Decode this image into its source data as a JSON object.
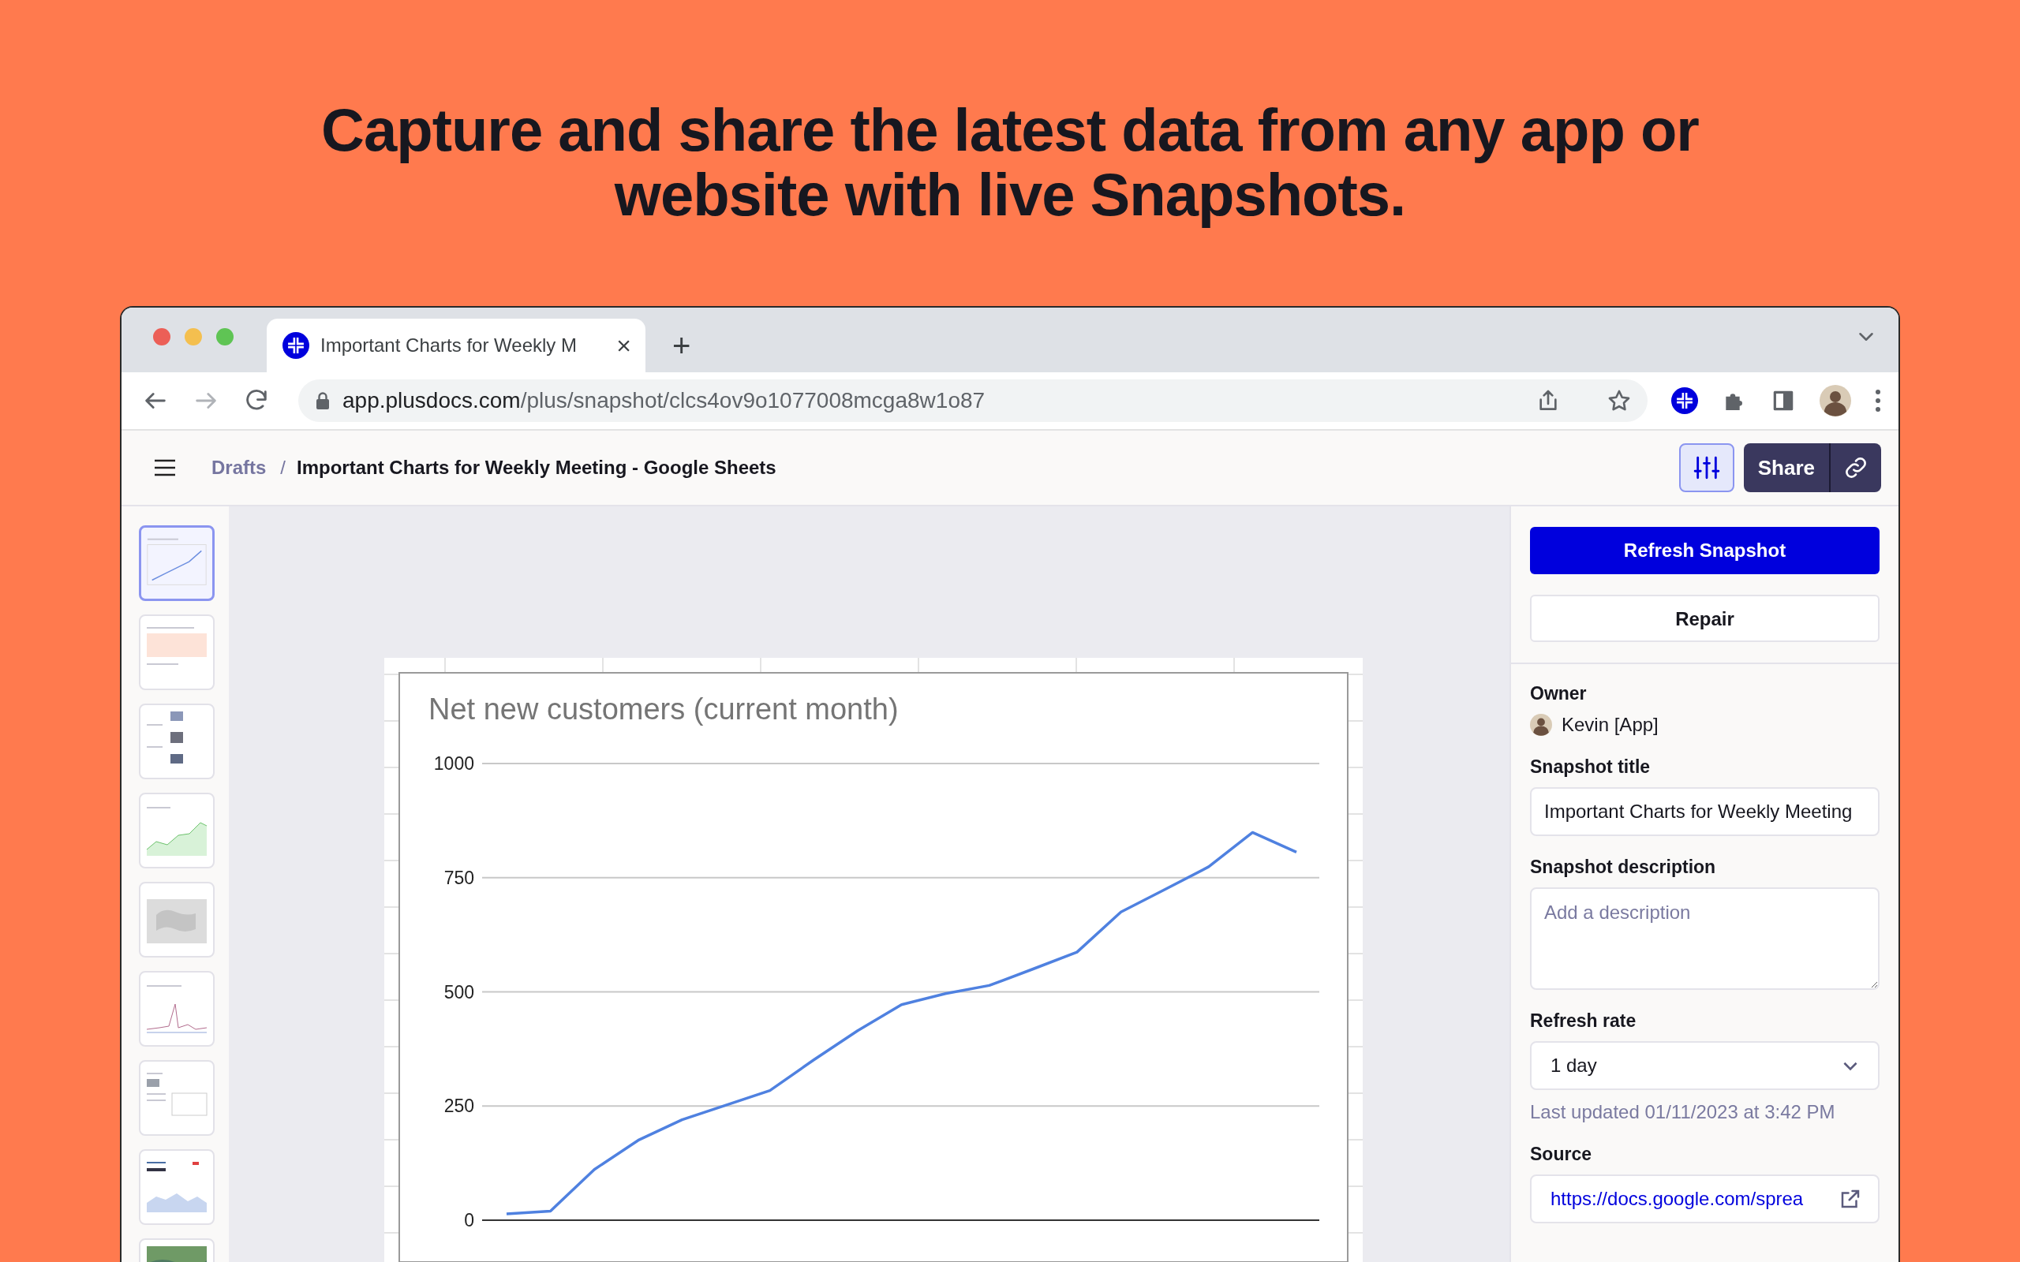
{
  "headline": "Capture and share the latest data from any app or website with live Snapshots.",
  "browser": {
    "tab": {
      "title": "Important Charts for Weekly M",
      "close": "×"
    },
    "new_tab": "+",
    "address": {
      "host": "app.plusdocs.com",
      "path": "/plus/snapshot/clcs4ov9o1077008mcga8w1o87"
    }
  },
  "header": {
    "breadcrumbs": [
      {
        "label": "Drafts",
        "kind": "link"
      },
      {
        "label": "/",
        "kind": "separator"
      },
      {
        "label": "Important Charts for Weekly Meeting - Google Sheets",
        "kind": "current"
      }
    ],
    "share_button": "Share"
  },
  "thumbnails": [
    {
      "kind": "line-chart",
      "selected": true
    },
    {
      "kind": "banner",
      "selected": false
    },
    {
      "kind": "gallery",
      "selected": false
    },
    {
      "kind": "area-chart",
      "selected": false
    },
    {
      "kind": "map",
      "selected": false
    },
    {
      "kind": "spike-chart",
      "selected": false
    },
    {
      "kind": "table",
      "selected": false
    },
    {
      "kind": "stock-chart",
      "selected": false
    },
    {
      "kind": "terrain",
      "selected": false
    }
  ],
  "chart": {
    "chart_data": {
      "type": "line",
      "title": "Net new customers (current month)",
      "grid": true,
      "ylim": [
        0,
        1000
      ],
      "yticks": [
        0,
        250,
        500,
        750,
        1000
      ],
      "series": [
        {
          "color": "#4f81e0",
          "values": [
            14,
            20,
            111,
            175,
            220,
            252,
            284,
            351,
            415,
            472,
            496,
            514,
            550,
            587,
            675,
            724,
            774,
            849,
            806
          ]
        }
      ]
    }
  },
  "panel": {
    "refresh_button": "Refresh Snapshot",
    "repair_button": "Repair",
    "owner": {
      "label": "Owner",
      "name": "Kevin [App]"
    },
    "title": {
      "label": "Snapshot title",
      "value": "Important Charts for Weekly Meeting"
    },
    "description": {
      "label": "Snapshot description",
      "placeholder": "Add a description"
    },
    "refresh_rate": {
      "label": "Refresh rate",
      "value": "1 day"
    },
    "last_updated": "Last updated 01/11/2023 at 3:42 PM",
    "source": {
      "label": "Source",
      "url": "https://docs.google.com/sprea"
    }
  }
}
